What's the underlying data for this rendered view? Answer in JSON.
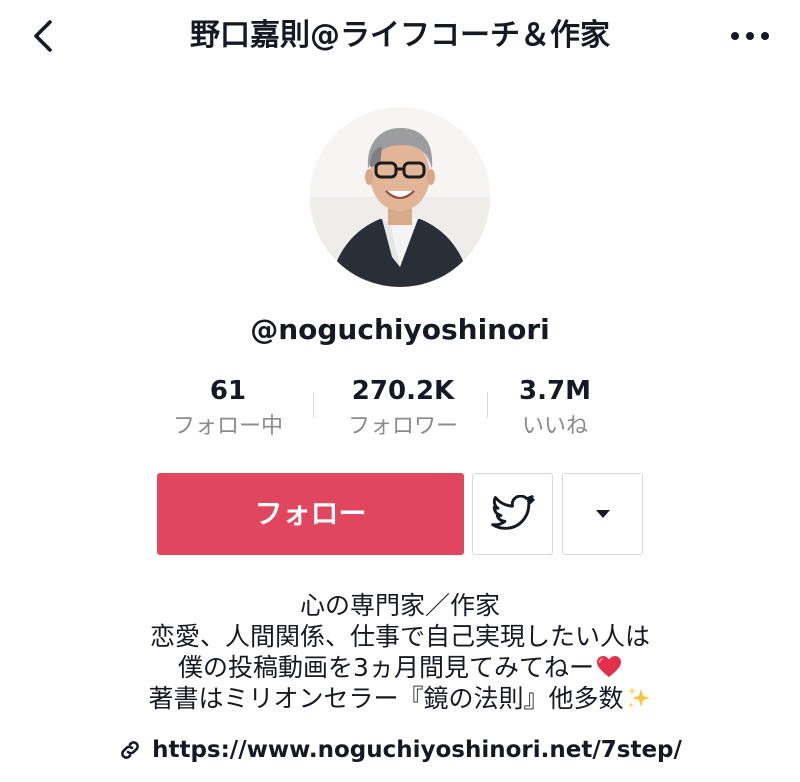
{
  "header": {
    "title": "野口嘉則@ライフコーチ＆作家",
    "back_icon": "chevron-left-icon",
    "more_icon": "more-dots-icon"
  },
  "profile": {
    "avatar_icon": "profile-photo",
    "username": "@noguchiyoshinori"
  },
  "stats": {
    "following": {
      "value": "61",
      "label": "フォロー中"
    },
    "followers": {
      "value": "270.2K",
      "label": "フォロワー"
    },
    "likes": {
      "value": "3.7M",
      "label": "いいね"
    }
  },
  "actions": {
    "follow_label": "フォロー",
    "twitter_icon": "twitter-bird-icon",
    "dropdown_icon": "caret-down-icon"
  },
  "bio": {
    "lines": [
      "心の専門家／作家",
      "恋愛、人間関係、仕事で自己実現したい人は",
      "僕の投稿動画を3ヵ月間見てみてねー",
      "著書はミリオンセラー『鏡の法則』他多数"
    ],
    "line3_emoji": "heart-emoji",
    "line4_emoji": "sparkles-emoji"
  },
  "link": {
    "icon": "link-icon",
    "url": "https://www.noguchiyoshinori.net/7step/"
  },
  "colors": {
    "follow_button": "#e0465e",
    "text_primary": "#161823",
    "text_secondary": "#8a8b91",
    "border": "#d8d8dc",
    "heart": "#e0304a",
    "sparkle": "#f6c542"
  }
}
